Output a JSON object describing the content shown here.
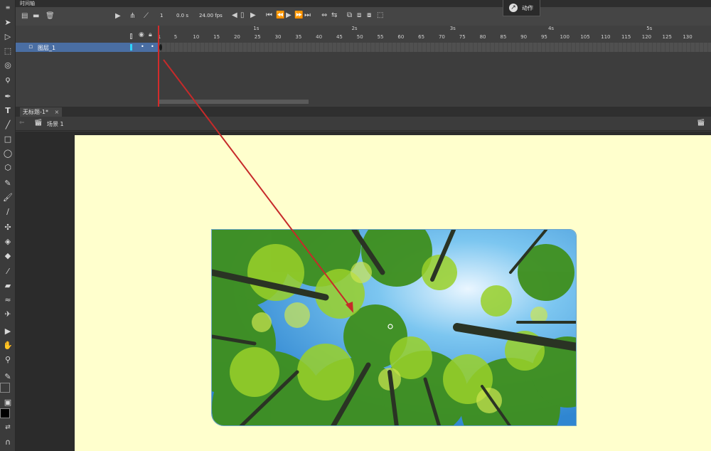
{
  "timeline": {
    "panel_title": "时间轴",
    "current_frame": "1",
    "time": "0.0 s",
    "fps": "24.00 fps",
    "layer_name": "图层_1",
    "seconds": [
      "1s",
      "2s",
      "3s",
      "4s",
      "5s"
    ],
    "frame_numbers": [
      "1",
      "5",
      "10",
      "15",
      "20",
      "25",
      "30",
      "35",
      "40",
      "45",
      "50",
      "55",
      "60",
      "65",
      "70",
      "75",
      "80",
      "85",
      "90",
      "95",
      "100",
      "105",
      "110",
      "115",
      "120",
      "125",
      "130"
    ]
  },
  "actions_panel": {
    "label": "动作"
  },
  "document": {
    "tab_title": "无标题-1*",
    "tab_close": "×",
    "scene_label": "场景 1"
  },
  "colors": {
    "stage": "#ffffcd",
    "layer_highlight": "#4a6ea3",
    "playhead": "#d32b2b",
    "annotation_arrow": "#c62a2a"
  },
  "icons": [
    "select-icon",
    "subselect-icon",
    "free-transform-icon",
    "3d-rotation-icon",
    "lasso-icon",
    "pen-icon",
    "text-icon",
    "line-icon",
    "rectangle-icon",
    "oval-icon",
    "polystar-icon",
    "pencil-icon",
    "brush-icon",
    "paint-brush-icon",
    "bone-icon",
    "paint-bucket-icon",
    "ink-bottle-icon",
    "eyedropper-icon",
    "eraser-icon",
    "width-icon",
    "pin-icon",
    "camera-icon",
    "hand-icon",
    "zoom-icon"
  ]
}
